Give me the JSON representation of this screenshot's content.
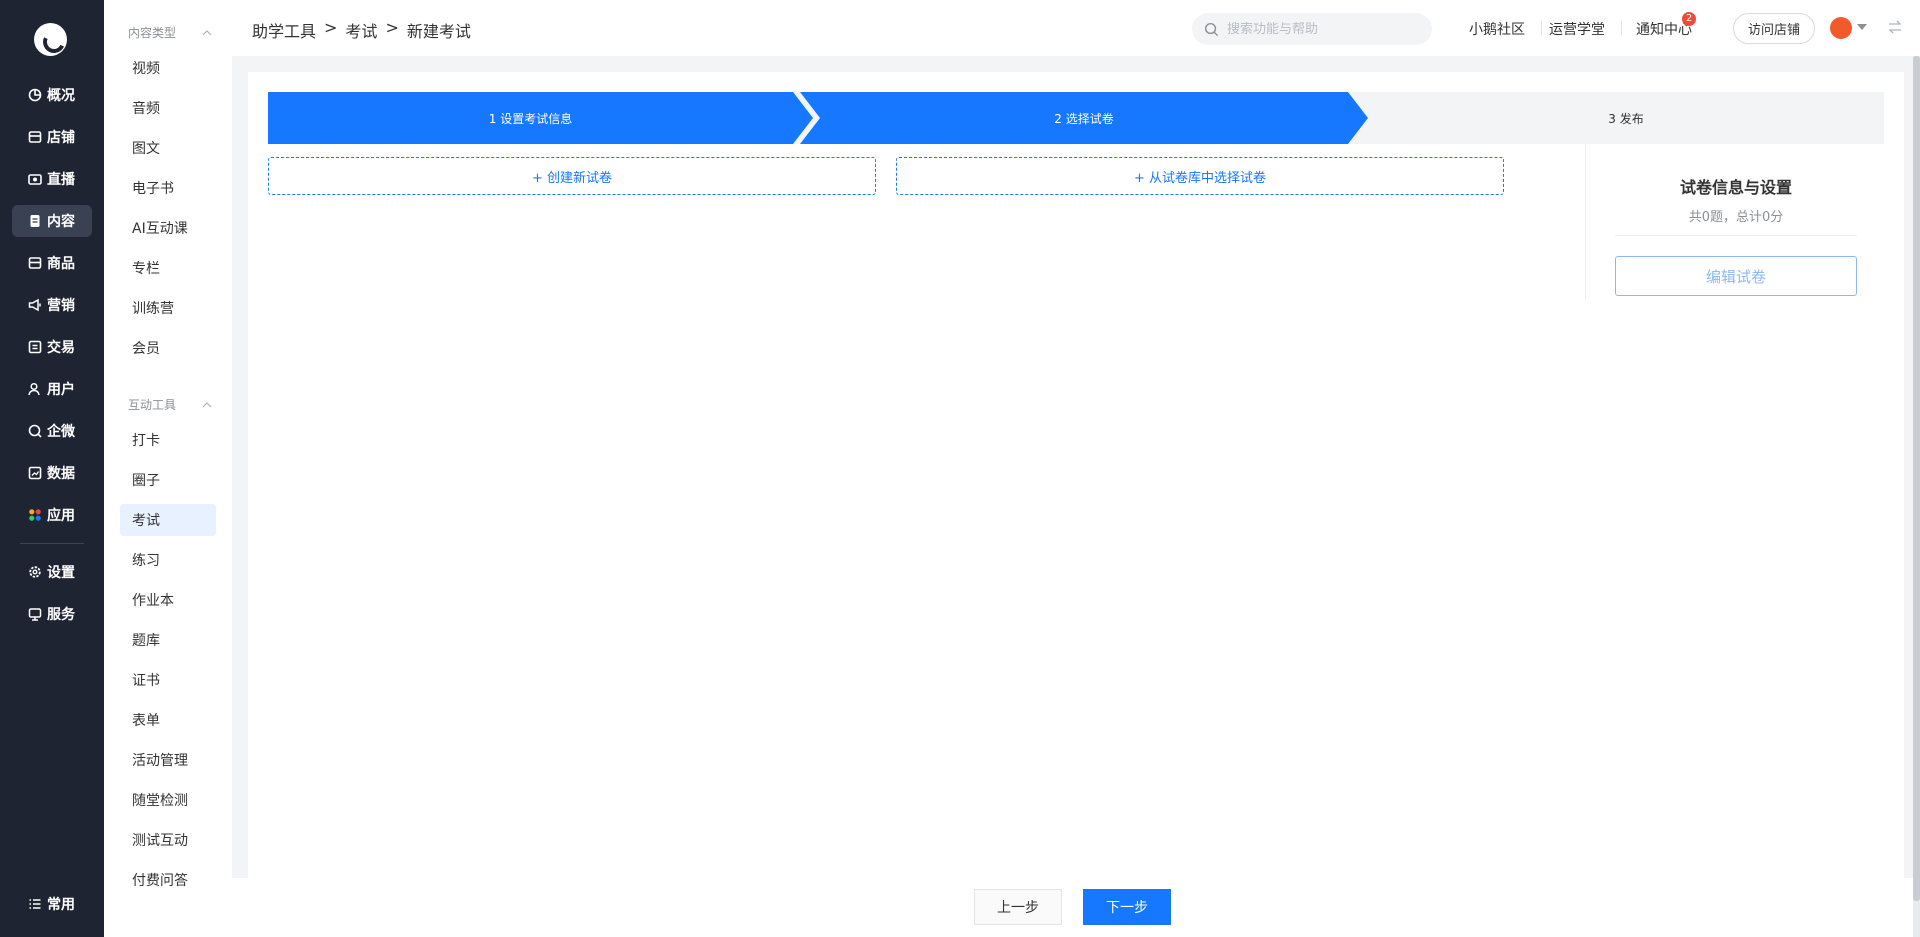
{
  "nav": {
    "items": [
      {
        "label": "概况",
        "icon": "pie-chart-icon"
      },
      {
        "label": "店铺",
        "icon": "store-icon"
      },
      {
        "label": "直播",
        "icon": "video-camera-icon"
      },
      {
        "label": "内容",
        "icon": "document-icon"
      },
      {
        "label": "商品",
        "icon": "box-icon"
      },
      {
        "label": "营销",
        "icon": "megaphone-icon"
      },
      {
        "label": "交易",
        "icon": "transaction-icon"
      },
      {
        "label": "用户",
        "icon": "user-icon"
      },
      {
        "label": "企微",
        "icon": "wecom-icon"
      },
      {
        "label": "数据",
        "icon": "data-chart-icon"
      },
      {
        "label": "应用",
        "icon": "apps-icon"
      },
      {
        "label": "设置",
        "icon": "gear-icon"
      },
      {
        "label": "服务",
        "icon": "service-icon"
      }
    ],
    "bottom": {
      "label": "常用",
      "icon": "list-icon"
    }
  },
  "subnav": {
    "groups": [
      {
        "title": "内容类型",
        "items": [
          "视频",
          "音频",
          "图文",
          "电子书",
          "AI互动课",
          "专栏",
          "训练营",
          "会员"
        ]
      },
      {
        "title": "互动工具",
        "items": [
          "打卡",
          "圈子",
          "考试",
          "练习",
          "作业本",
          "题库",
          "证书",
          "表单",
          "活动管理",
          "随堂检测",
          "测试互动",
          "付费问答"
        ]
      }
    ],
    "active": "考试"
  },
  "header": {
    "breadcrumb": [
      "助学工具",
      ">",
      "考试",
      ">",
      "新建考试"
    ],
    "search_placeholder": "搜索功能与帮助",
    "links": [
      "小鹅社区",
      "运营学堂",
      "通知中心"
    ],
    "notify_count": "2",
    "visit_label": "访问店铺"
  },
  "steps": [
    "1 设置考试信息",
    "2 选择试卷",
    "3 发布"
  ],
  "actions": {
    "create": "+ 创建新试卷",
    "select": "+ 从试卷库中选择试卷"
  },
  "side_card": {
    "title": "试卷信息与设置",
    "summary": "共0题，总计0分",
    "edit_label": "编辑试卷"
  },
  "footer": {
    "prev_label": "上一步",
    "next_label": "下一步"
  },
  "colors": {
    "primary": "#1677ff",
    "nav_bg": "#1f2433"
  }
}
